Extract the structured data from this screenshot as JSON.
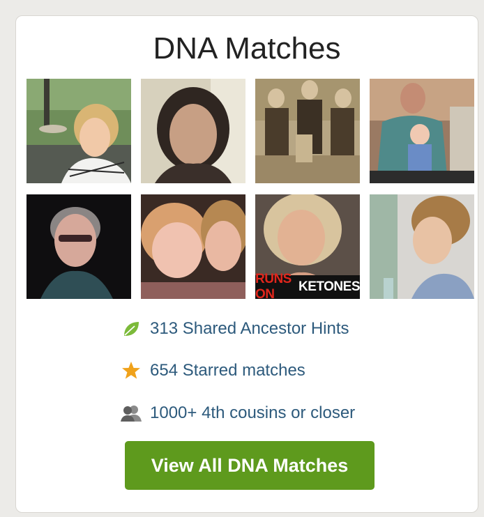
{
  "widget": {
    "title": "DNA Matches",
    "thumbnails": [
      {
        "icon": "woman-portrait"
      },
      {
        "icon": "woman-portrait"
      },
      {
        "icon": "vintage-group-photo"
      },
      {
        "icon": "man-with-baby"
      },
      {
        "icon": "woman-with-glasses"
      },
      {
        "icon": "mother-and-child"
      },
      {
        "icon": "woman-with-caption",
        "caption_red": "RUNS ON",
        "caption_white": "KETONES"
      },
      {
        "icon": "child-profile"
      }
    ],
    "stats": [
      {
        "icon": "leaf-icon",
        "label": "313 Shared Ancestor Hints",
        "color": "#7cba3a"
      },
      {
        "icon": "star-icon",
        "label": "654 Starred matches",
        "color": "#f0a21b"
      },
      {
        "icon": "people-icon",
        "label": "1000+ 4th cousins or closer",
        "color": "#6b6b6b"
      }
    ],
    "button_label": "View All DNA Matches"
  },
  "colors": {
    "button": "#5e9a1d",
    "link_text": "#2d5a7c",
    "page_bg": "#ecebe8"
  }
}
